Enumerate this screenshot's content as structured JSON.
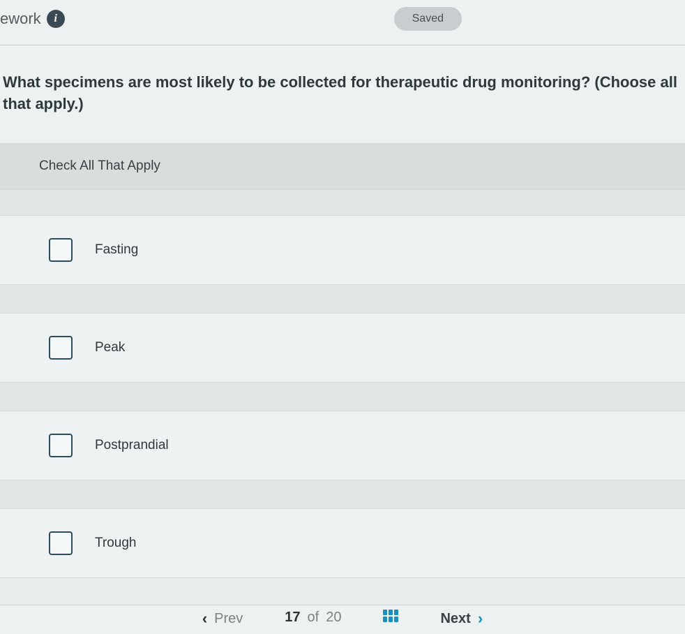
{
  "header": {
    "breadcrumb": "ework",
    "info_icon_glyph": "i",
    "status_pill": "Saved"
  },
  "question": {
    "text": "What specimens are most likely to be collected for therapeutic drug monitoring? (Choose all that apply.)",
    "instructions": "Check All That Apply"
  },
  "options": [
    {
      "label": "Fasting",
      "checked": false
    },
    {
      "label": "Peak",
      "checked": false
    },
    {
      "label": "Postprandial",
      "checked": false
    },
    {
      "label": "Trough",
      "checked": false
    }
  ],
  "nav": {
    "prev_label": "Prev",
    "next_label": "Next",
    "current": "17",
    "of_word": "of",
    "total": "20"
  }
}
